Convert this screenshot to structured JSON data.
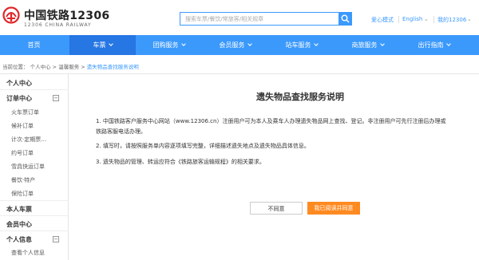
{
  "header": {
    "logo_text": "中国铁路12306",
    "logo_subtext": "12306 CHINA RAILWAY",
    "search_placeholder": "搜索车票/餐饮/常旅客/相关规章",
    "care_mode": "爱心模式",
    "language": "English",
    "my_account": "我的12306"
  },
  "nav": [
    {
      "label": "首页"
    },
    {
      "label": "车票"
    },
    {
      "label": "团购服务"
    },
    {
      "label": "会员服务"
    },
    {
      "label": "站车服务"
    },
    {
      "label": "商旅服务"
    },
    {
      "label": "出行指南"
    }
  ],
  "breadcrumb": {
    "prefix": "当前位置：",
    "items": [
      "个人中心",
      "温馨服务"
    ],
    "current": "遗失物品查找服务说明",
    "sep": ">"
  },
  "sidebar": {
    "personal_center": "个人中心",
    "orders_title": "订单中心",
    "orders": [
      "火车票订单",
      "候补订单",
      "计次·定期票…",
      "约号订单",
      "雪具快运订单",
      "餐饮·特产",
      "保险订单"
    ],
    "my_tickets": "本人车票",
    "member_center": "会员中心",
    "personal_info_title": "个人信息",
    "personal_info_items": [
      "查看个人信息"
    ],
    "toggle_symbol": "−"
  },
  "main": {
    "title": "遗失物品查找服务说明",
    "paragraphs": [
      "1.  中国铁路客户服务中心网站（www.12306.cn）注册用户可为本人及乘车人办理遗失物品网上查找、登记。非注册用户可先行注册后办理或",
      "铁路客服电话办理。",
      "2.  填写时，请按照服务单内容逐项填写完整，详细描述遗失地点及遗失物品具体信息。",
      "3.  遗失物品的管理、转运应符合《铁路旅客运输规程》的相关要求。"
    ],
    "cancel_button": "不同意",
    "agree_button": "我已阅读并同意"
  },
  "colors": {
    "brand_blue": "#3b99fc",
    "logo_red": "#e0262b",
    "agree_orange": "#ff8a21"
  }
}
